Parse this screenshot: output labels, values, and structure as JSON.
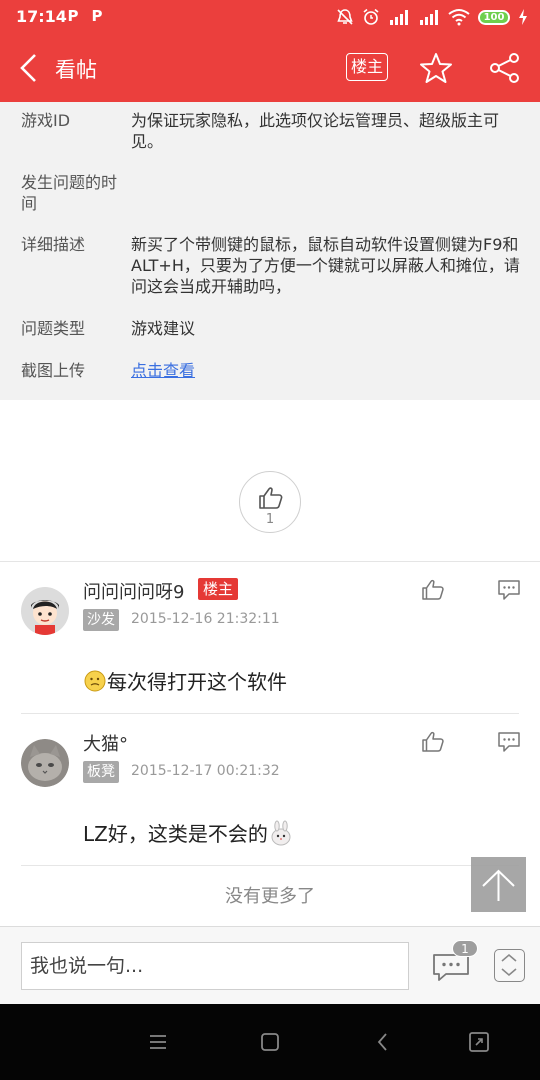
{
  "status_bar": {
    "time": "17:14",
    "app_badges": [
      "P",
      "P"
    ],
    "battery": "100"
  },
  "header": {
    "title": "看帖",
    "op_button": "楼主"
  },
  "info": [
    {
      "label": "游戏ID",
      "value": "为保证玩家隐私，此选项仅论坛管理员、超级版主可见。"
    },
    {
      "label": "发生问题的时间",
      "value": ""
    },
    {
      "label": "详细描述",
      "value": "新买了个带侧键的鼠标，鼠标自动软件设置侧键为F9和ALT+H，只要为了方便一个键就可以屏蔽人和摊位，请问这会当成开辅助吗，"
    },
    {
      "label": "问题类型",
      "value": "游戏建议"
    },
    {
      "label": "截图上传",
      "value": "点击查看"
    }
  ],
  "like": {
    "count": "1"
  },
  "comments": [
    {
      "name": "问问问问呀9",
      "op_tag": "楼主",
      "floor": "沙发",
      "time": "2015-12-16 21:32:11",
      "text": "每次得打开这个软件"
    },
    {
      "name": "大猫°",
      "op_tag": "",
      "floor": "板凳",
      "time": "2015-12-17 00:21:32",
      "text": "LZ好，这类是不会的"
    }
  ],
  "no_more": "没有更多了",
  "bottom_bar": {
    "placeholder": "我也说一句...",
    "comment_count": "1"
  },
  "colors": {
    "brand_red": "#eb3f3d",
    "link_blue": "#3a6fe0"
  }
}
